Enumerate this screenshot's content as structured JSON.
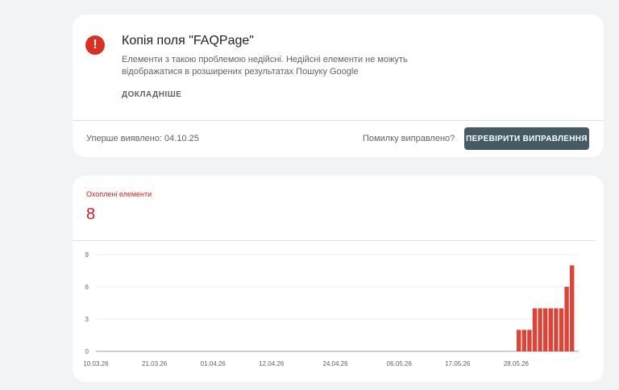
{
  "issue": {
    "icon": "error-icon",
    "icon_glyph": "!",
    "title": "Копія поля \"FAQPage\"",
    "description_line1": "Елементи з такою проблемою недійсні. Недійсні елементи не можуть",
    "description_line2": "відображатися в розширених результатах Пошуку Google",
    "details_label": "ДОКЛАДНІШЕ",
    "first_detected": "Уперше виявлено: 04.10.25",
    "fixed_question": "Помилку виправлено?",
    "validate_label": "ПЕРЕВІРИТИ ВИПРАВЛЕННЯ"
  },
  "metric": {
    "label": "Охоплені елементи",
    "value": "8"
  },
  "colors": {
    "error": "#d93025",
    "bar": "#db4437",
    "button": "#455a64"
  },
  "chart_data": {
    "type": "bar",
    "title": "",
    "xlabel": "",
    "ylabel": "",
    "ylim": [
      0,
      9
    ],
    "yticks": [
      0,
      3,
      6,
      9
    ],
    "x_tick_labels": [
      "10.03.26",
      "21.03.26",
      "01.04.26",
      "12.04.26",
      "24.04.26",
      "06.05.26",
      "17.05.26",
      "28.05.26"
    ],
    "x_start": "2026-03-10",
    "x_end": "2026-06-05",
    "bars": [
      {
        "x": "2026-05-28",
        "value": 2
      },
      {
        "x": "2026-05-29",
        "value": 2
      },
      {
        "x": "2026-05-30",
        "value": 2
      },
      {
        "x": "2026-05-31",
        "value": 4
      },
      {
        "x": "2026-06-01",
        "value": 4
      },
      {
        "x": "2026-06-02",
        "value": 4
      },
      {
        "x": "2026-06-03",
        "value": 4
      },
      {
        "x": "2026-06-04",
        "value": 4
      },
      {
        "x": "2026-06-05",
        "value": 4
      },
      {
        "x": "2026-06-06",
        "value": 6
      },
      {
        "x": "2026-06-07",
        "value": 8
      }
    ]
  }
}
